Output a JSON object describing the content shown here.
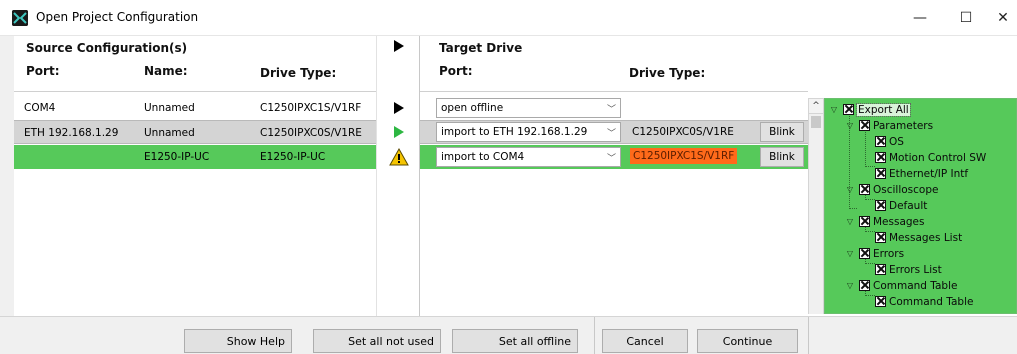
{
  "window": {
    "title": "Open Project Configuration",
    "minimize_glyph": "—",
    "maximize_glyph": "☐",
    "close_glyph": "✕"
  },
  "source": {
    "section_title": "Source Configuration(s)",
    "headers": {
      "port": "Port:",
      "name": "Name:",
      "drive_type": "Drive Type:"
    },
    "rows": [
      {
        "port": "COM4",
        "name": "Unnamed",
        "drive_type": "C1250IPXC1S/V1RF"
      },
      {
        "port": "ETH 192.168.1.29",
        "name": "Unnamed",
        "drive_type": "C1250IPXC0S/V1RE"
      },
      {
        "port": "",
        "name": "E1250-IP-UC",
        "drive_type": "E1250-IP-UC"
      }
    ]
  },
  "indicators": [
    {
      "icon": "play-arrow-icon",
      "color": "#000000"
    },
    {
      "icon": "play-arrow-icon",
      "color": "#2db742"
    },
    {
      "icon": "warning-icon",
      "color": "#f5c400"
    }
  ],
  "target": {
    "section_title": "Target Drive",
    "headers": {
      "port": "Port:",
      "drive_type": "Drive Type:"
    },
    "rows": [
      {
        "port_select": "open offline",
        "drive_type": "",
        "blink": ""
      },
      {
        "port_select": "import to ETH 192.168.1.29",
        "drive_type": "C1250IPXC0S/V1RE",
        "blink": "Blink"
      },
      {
        "port_select": "import to COM4",
        "drive_type": "C1250IPXC1S/V1RF",
        "blink": "Blink"
      }
    ],
    "mismatch_color": "#ff6a1a"
  },
  "tree": {
    "scroll_up_glyph": "^",
    "items": [
      {
        "label": "Export All",
        "checked": true,
        "expanded": true,
        "level": 0
      },
      {
        "label": "Parameters",
        "checked": true,
        "expanded": true,
        "level": 1
      },
      {
        "label": "OS",
        "checked": true,
        "level": 2
      },
      {
        "label": "Motion Control SW",
        "checked": true,
        "level": 2
      },
      {
        "label": "Ethernet/IP Intf",
        "checked": true,
        "level": 2
      },
      {
        "label": "Oscilloscope",
        "checked": true,
        "expanded": true,
        "level": 1
      },
      {
        "label": "Default",
        "checked": true,
        "level": 2
      },
      {
        "label": "Messages",
        "checked": true,
        "expanded": true,
        "level": 1
      },
      {
        "label": "Messages List",
        "checked": true,
        "level": 2
      },
      {
        "label": "Errors",
        "checked": true,
        "expanded": true,
        "level": 1
      },
      {
        "label": "Errors List",
        "checked": true,
        "level": 2
      },
      {
        "label": "Command Table",
        "checked": true,
        "expanded": true,
        "level": 1
      },
      {
        "label": "Command Table",
        "checked": true,
        "level": 2
      }
    ]
  },
  "buttons": {
    "show_help": "Show Help",
    "set_all_not_used": "Set all not used",
    "set_all_offline": "Set all offline",
    "cancel": "Cancel",
    "continue": "Continue"
  },
  "colors": {
    "selected_row": "#56c95a",
    "gray_row": "#d4d4d4"
  }
}
